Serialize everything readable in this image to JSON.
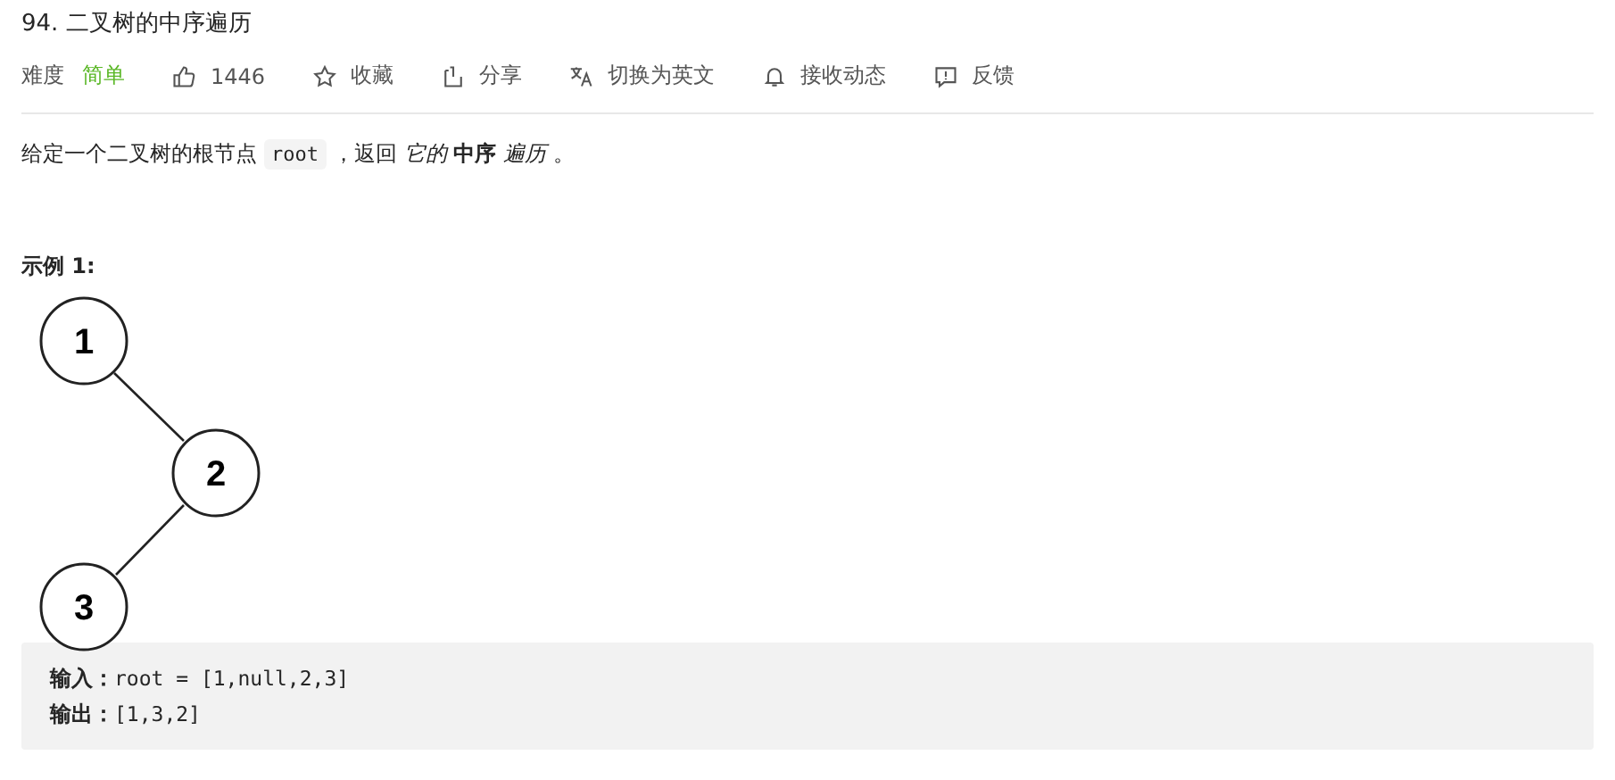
{
  "title": "94. 二叉树的中序遍历",
  "meta": {
    "difficulty_label": "难度",
    "difficulty": "简单",
    "actions": [
      {
        "kind": "like",
        "label": "1446"
      },
      {
        "kind": "star",
        "label": "收藏"
      },
      {
        "kind": "share",
        "label": "分享"
      },
      {
        "kind": "translate",
        "label": "切换为英文"
      },
      {
        "kind": "bell",
        "label": "接收动态"
      },
      {
        "kind": "feedback",
        "label": "反馈"
      }
    ]
  },
  "description": [
    {
      "kind": "text",
      "text": "给定一个二叉树的根节点"
    },
    {
      "kind": "code",
      "text": "root"
    },
    {
      "kind": "text",
      "text": "，返回 *它的* **中序** *遍历* 。"
    }
  ],
  "example": {
    "heading": "示例 1:",
    "tree": {
      "nodes": [
        "1",
        "2",
        "3"
      ]
    },
    "lines": [
      {
        "label": "输入：",
        "value": "root = [1,null,2,3]"
      },
      {
        "label": "输出：",
        "value": "[1,3,2]"
      }
    ]
  }
}
